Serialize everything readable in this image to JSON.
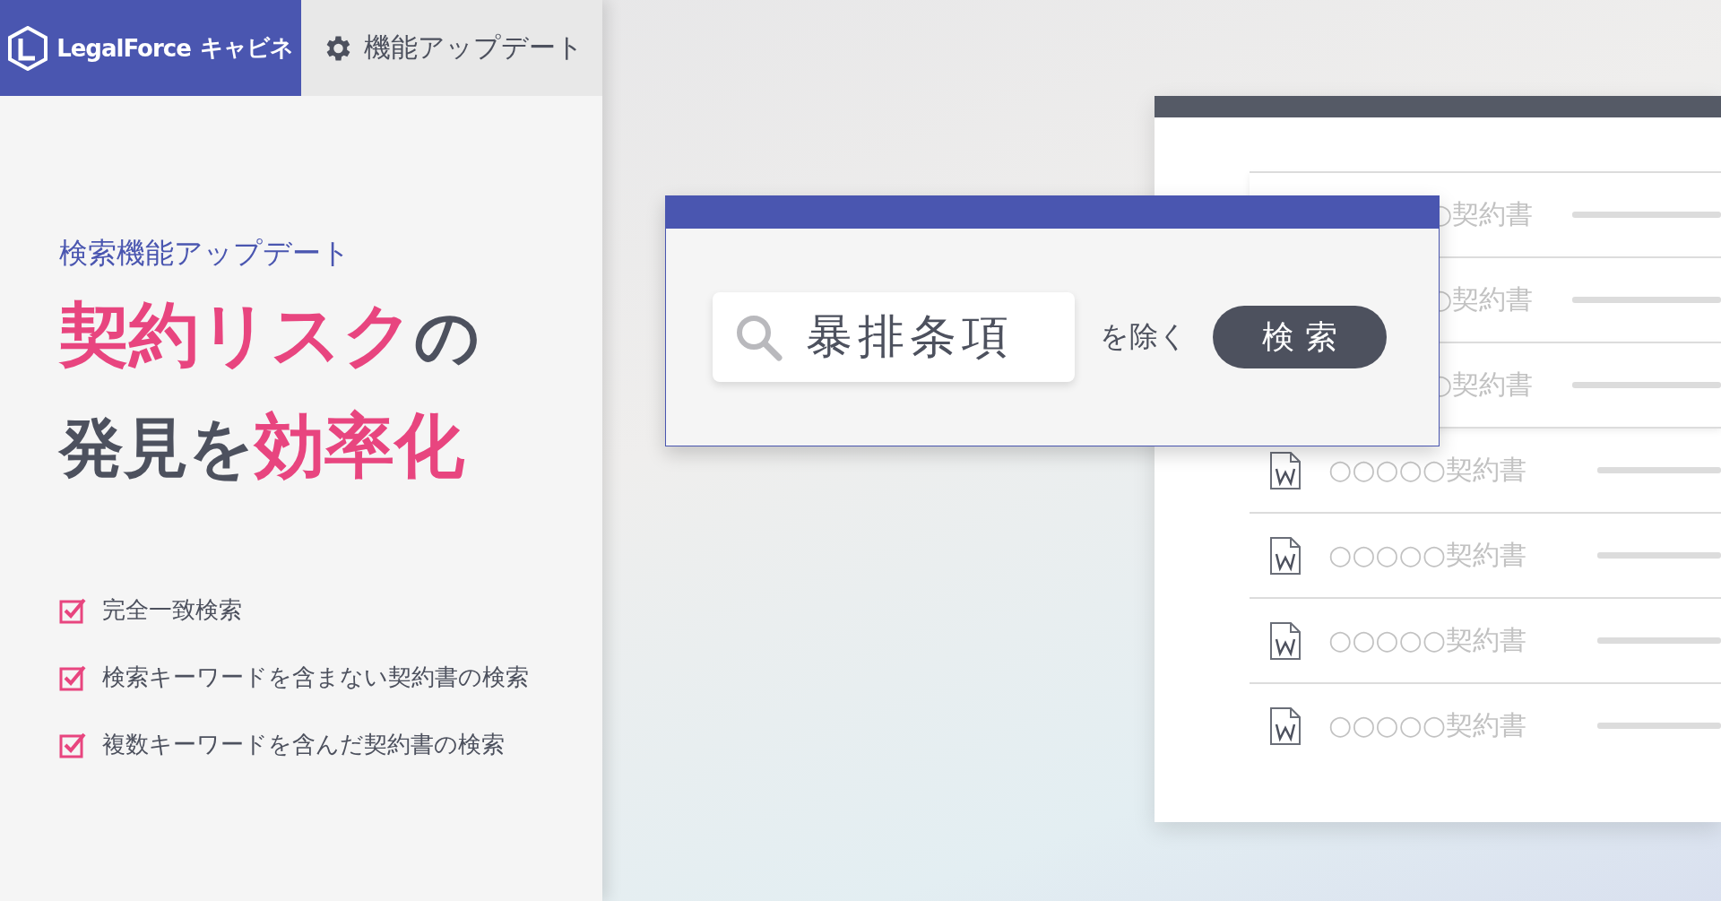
{
  "header": {
    "logo": {
      "wordmark": "LegalForce",
      "product": "キャビネ"
    },
    "tab": {
      "label": "機能アップデート"
    }
  },
  "hero": {
    "subtitle": "検索機能アップデート",
    "headline": [
      [
        {
          "text": "契約リスク",
          "accent": true
        },
        {
          "text": "の",
          "accent": false
        }
      ],
      [
        {
          "text": "発見を",
          "accent": false
        },
        {
          "text": "効率化",
          "accent": true
        }
      ]
    ],
    "features": [
      {
        "label": "完全一致検索",
        "checked": true
      },
      {
        "label": "検索キーワードを含まない契約書の検索",
        "checked": true
      },
      {
        "label": "複数キーワードを含んだ契約書の検索",
        "checked": true
      }
    ]
  },
  "search_dialog": {
    "query": "暴排条項",
    "exclude_label": "を除く",
    "button": "検 索"
  },
  "documents": [
    {
      "kind": "covered",
      "name": "○契約書"
    },
    {
      "kind": "covered",
      "name": "○契約書"
    },
    {
      "kind": "covered",
      "name": "○契約書"
    },
    {
      "kind": "file",
      "name": "○○○○○契約書"
    },
    {
      "kind": "file",
      "name": "○○○○○契約書"
    },
    {
      "kind": "file",
      "name": "○○○○○契約書"
    },
    {
      "kind": "file",
      "name": "○○○○○契約書"
    }
  ]
}
